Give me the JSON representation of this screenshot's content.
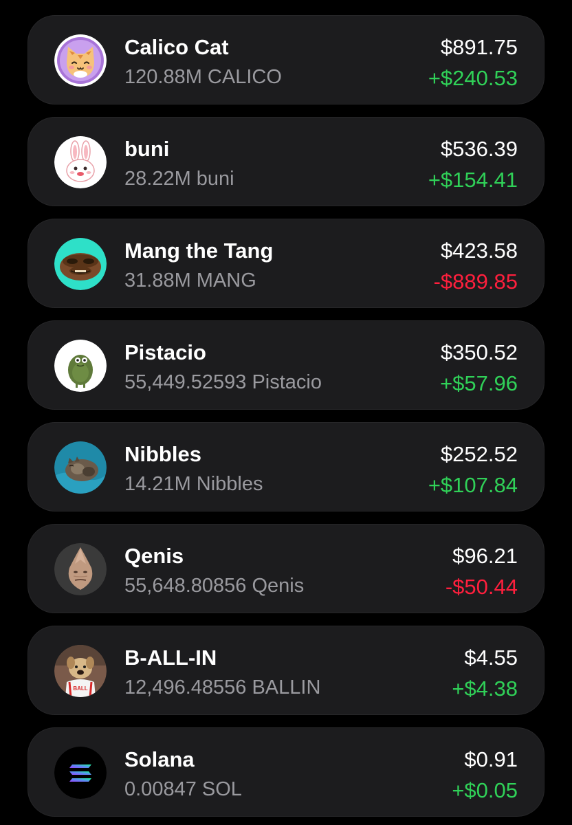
{
  "colors": {
    "background": "#000000",
    "card": "#1c1c1e",
    "positive": "#30d158",
    "negative": "#ff1f3d",
    "secondary_text": "#9a9a9f"
  },
  "tokens": [
    {
      "name": "Calico Cat",
      "amount": "120.88M CALICO",
      "value": "$891.75",
      "change": "+$240.53",
      "direction": "up",
      "icon": "calico-cat-icon"
    },
    {
      "name": "buni",
      "amount": "28.22M buni",
      "value": "$536.39",
      "change": "+$154.41",
      "direction": "up",
      "icon": "bunny-icon"
    },
    {
      "name": "Mang the Tang",
      "amount": "31.88M MANG",
      "value": "$423.58",
      "change": "-$889.85",
      "direction": "down",
      "icon": "frog-face-icon"
    },
    {
      "name": "Pistacio",
      "amount": "55,449.52593 Pistacio",
      "value": "$350.52",
      "change": "+$57.96",
      "direction": "up",
      "icon": "green-frog-icon"
    },
    {
      "name": "Nibbles",
      "amount": "14.21M Nibbles",
      "value": "$252.52",
      "change": "+$107.84",
      "direction": "up",
      "icon": "sleeping-cat-icon"
    },
    {
      "name": "Qenis",
      "amount": "55,648.80856 Qenis",
      "value": "$96.21",
      "change": "-$50.44",
      "direction": "down",
      "icon": "qenis-face-icon"
    },
    {
      "name": "B-ALL-IN",
      "amount": "12,496.48556 BALLIN",
      "value": "$4.55",
      "change": "+$4.38",
      "direction": "up",
      "icon": "basketball-dog-icon"
    },
    {
      "name": "Solana",
      "amount": "0.00847 SOL",
      "value": "$0.91",
      "change": "+$0.05",
      "direction": "up",
      "icon": "solana-logo-icon"
    }
  ]
}
